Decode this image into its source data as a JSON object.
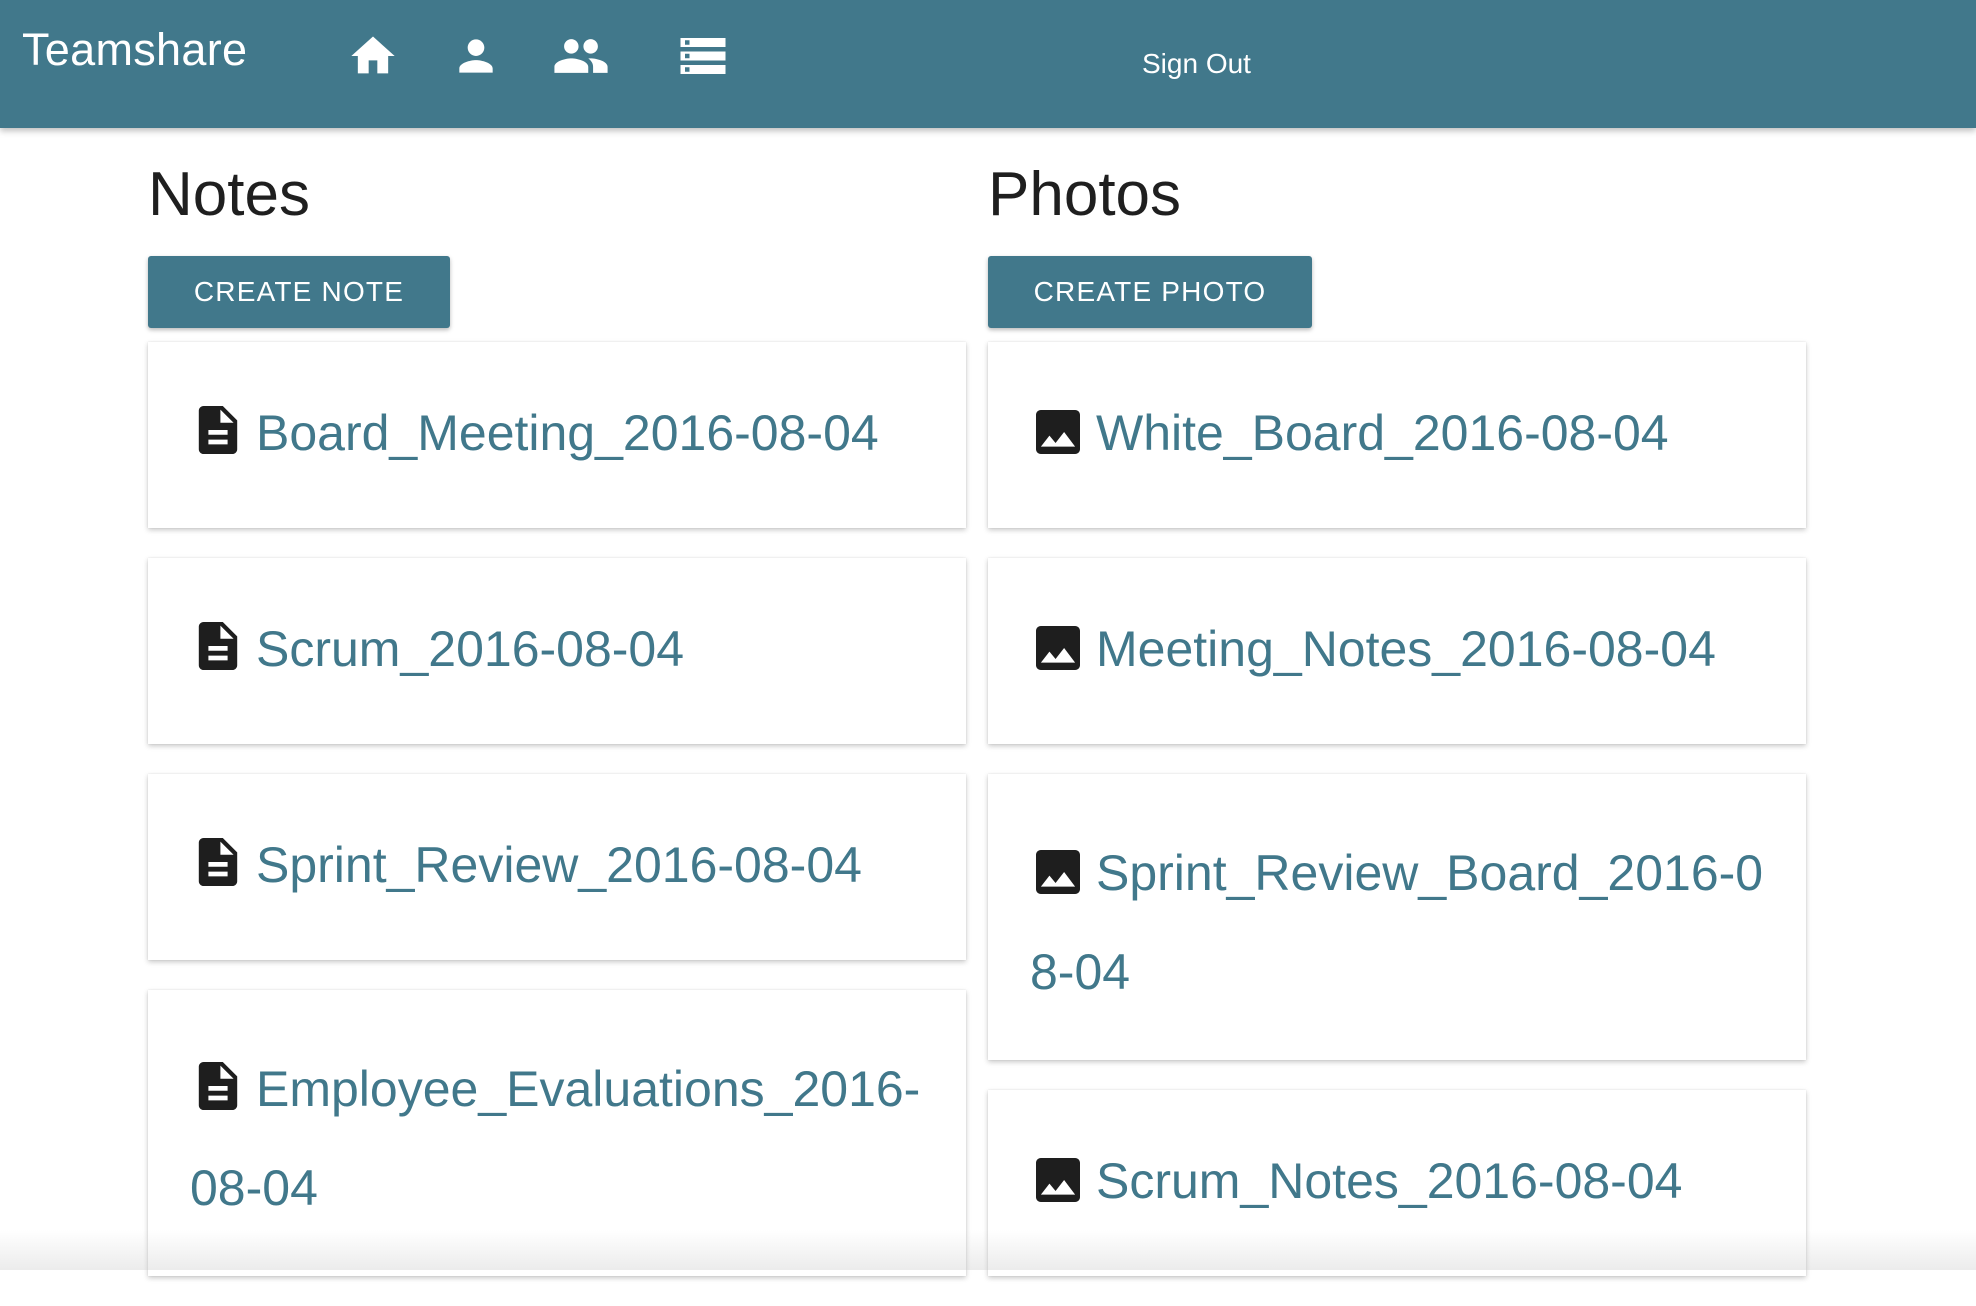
{
  "app": {
    "brand": "Teamshare"
  },
  "nav": {
    "icons": [
      "home-icon",
      "person-icon",
      "group-icon",
      "list-icon"
    ],
    "sign_out": "Sign Out"
  },
  "notes": {
    "title": "Notes",
    "create_label": "CREATE NOTE",
    "items": [
      {
        "label": "Board_Meeting_2016-08-04",
        "icon": "document-icon"
      },
      {
        "label": "Scrum_2016-08-04",
        "icon": "document-icon"
      },
      {
        "label": "Sprint_Review_2016-08-04",
        "icon": "document-icon"
      },
      {
        "label": "Employee_Evaluations_2016-08-04",
        "icon": "document-icon"
      }
    ]
  },
  "photos": {
    "title": "Photos",
    "create_label": "CREATE PHOTO",
    "items": [
      {
        "label": "White_Board_2016-08-04",
        "icon": "image-icon"
      },
      {
        "label": "Meeting_Notes_2016-08-04",
        "icon": "image-icon"
      },
      {
        "label": "Sprint_Review_Board_2016-08-04",
        "icon": "image-icon"
      },
      {
        "label": "Scrum_Notes_2016-08-04",
        "icon": "image-icon"
      }
    ]
  },
  "colors": {
    "primary": "#41788b",
    "text": "#1f1f1f",
    "icon": "#1e1e1e"
  }
}
